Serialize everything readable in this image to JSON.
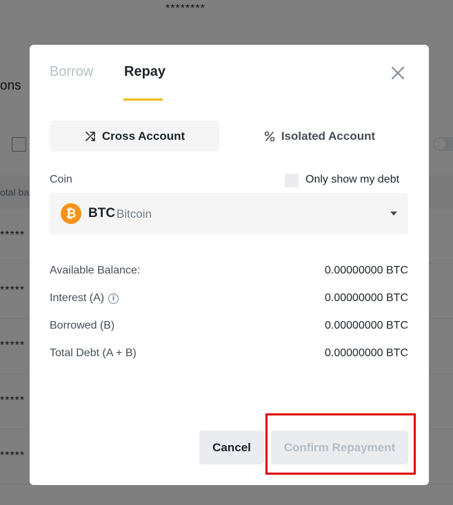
{
  "background": {
    "masked_top": "********",
    "heading": "ons",
    "table_header": "otal ba",
    "rows": [
      "*****",
      "*****",
      "*****",
      "*****",
      "*****"
    ]
  },
  "modal": {
    "tabs": [
      {
        "label": "Borrow",
        "active": false
      },
      {
        "label": "Repay",
        "active": true
      }
    ],
    "accent_color": "#f0b90b",
    "account_types": {
      "cross": "Cross Account",
      "isolated": "Isolated Account",
      "selected": "cross"
    },
    "coin": {
      "label": "Coin",
      "only_show_debt_label": "Only show my debt",
      "only_show_debt_checked": false,
      "selected_symbol": "BTC",
      "selected_name": "Bitcoin",
      "logo_glyph": "₿",
      "logo_color": "#f7931a"
    },
    "info": [
      {
        "label": "Available Balance:",
        "value": "0.00000000 BTC",
        "info_icon": false
      },
      {
        "label": "Interest (A)",
        "value": "0.00000000 BTC",
        "info_icon": true
      },
      {
        "label": "Borrowed (B)",
        "value": "0.00000000 BTC",
        "info_icon": false
      },
      {
        "label": "Total Debt (A + B)",
        "value": "0.00000000 BTC",
        "info_icon": false
      }
    ],
    "buttons": {
      "cancel": "Cancel",
      "confirm": "Confirm Repayment",
      "confirm_disabled": true
    }
  },
  "annotation": {
    "highlight_color": "#e00000",
    "target": "confirm-repayment-button"
  }
}
